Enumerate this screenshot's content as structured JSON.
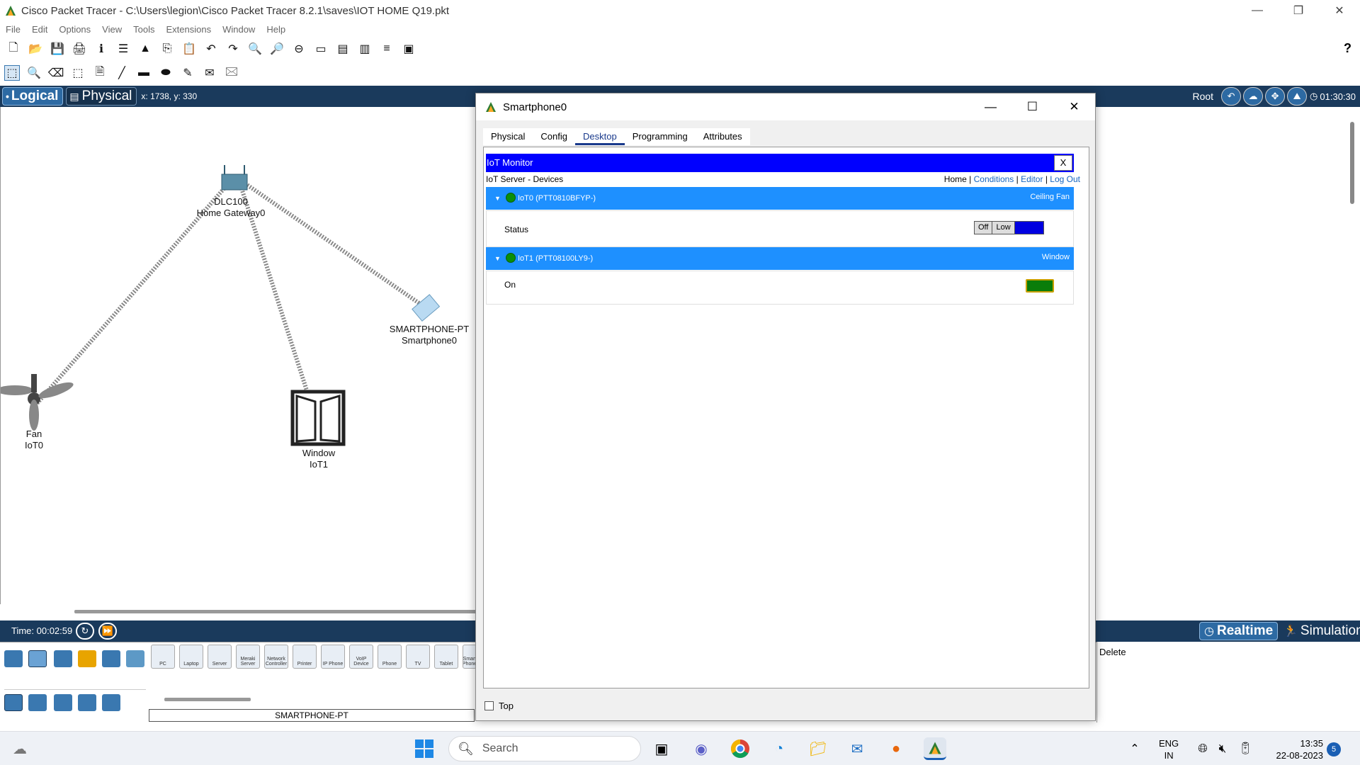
{
  "window": {
    "title": "Cisco Packet Tracer - C:\\Users\\legion\\Cisco Packet Tracer 8.2.1\\saves\\IOT HOME Q19.pkt"
  },
  "menu": [
    "File",
    "Edit",
    "Options",
    "View",
    "Tools",
    "Extensions",
    "Window",
    "Help"
  ],
  "workspace": {
    "logical_label": "Logical",
    "physical_label": "Physical",
    "coords": "x: 1738, y: 330",
    "root_label": "Root",
    "clock": "01:30:30"
  },
  "devices": [
    {
      "name": "DLC100",
      "sub": "Home Gateway0"
    },
    {
      "name": "SMARTPHONE-PT",
      "sub": "Smartphone0"
    },
    {
      "name": "Fan",
      "sub": "IoT0"
    },
    {
      "name": "Window",
      "sub": "IoT1"
    }
  ],
  "timebar": {
    "time": "Time: 00:02:59",
    "realtime": "Realtime",
    "simulation": "Simulation"
  },
  "device_panel": {
    "items": [
      "PC",
      "Laptop",
      "Server",
      "Meraki Server",
      "Network Controller",
      "Printer",
      "IP Phone",
      "VoIP Device",
      "Phone",
      "TV",
      "Tablet",
      "Smart Phone"
    ],
    "selected_name": "SMARTPHONE-PT"
  },
  "pdu": {
    "delete_label": "Delete"
  },
  "dialog": {
    "title": "Smartphone0",
    "tabs": [
      "Physical",
      "Config",
      "Desktop",
      "Programming",
      "Attributes"
    ],
    "active_tab": "Desktop",
    "iot": {
      "header": "IoT Monitor",
      "close": "X",
      "subtitle": "IoT Server - Devices",
      "nav": {
        "home": "Home",
        "conditions": "Conditions",
        "editor": "Editor",
        "logout": "Log Out",
        "sep": "|"
      },
      "dev0": {
        "name": "IoT0 (PTT0810BFYP-)",
        "type": "Ceiling Fan",
        "prop": "Status",
        "opt_off": "Off",
        "opt_low": "Low"
      },
      "dev1": {
        "name": "IoT1 (PTT08100LY9-)",
        "type": "Window",
        "prop": "On"
      }
    },
    "top_label": "Top"
  },
  "taskbar": {
    "search": "Search",
    "lang_top": "ENG",
    "lang_bottom": "IN",
    "time": "13:35",
    "date": "22-08-2023",
    "notifications": "5"
  },
  "colors": {
    "workspace_bar": "#1a3a5c",
    "iot_header": "#0000ff",
    "iot_device_bar": "#1e90ff"
  }
}
